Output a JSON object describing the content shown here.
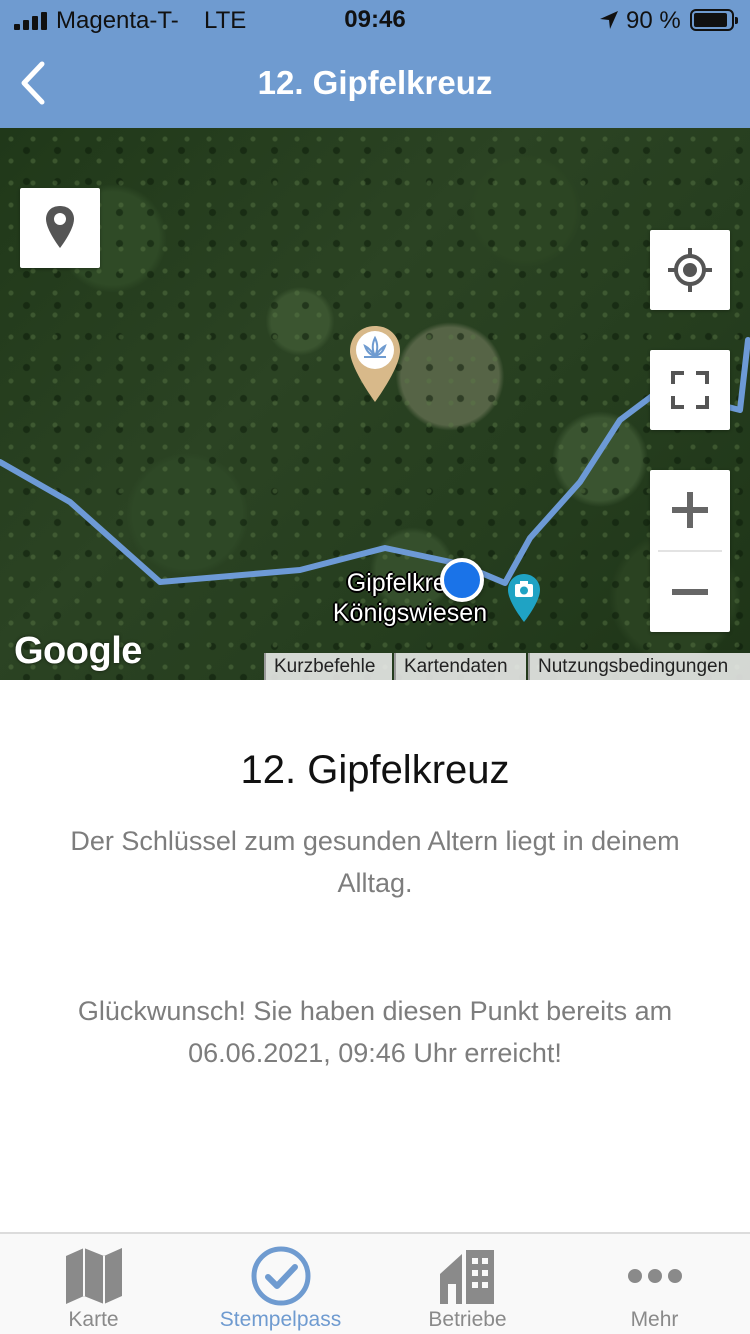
{
  "status_bar": {
    "carrier": "Magenta-T-",
    "network": "LTE",
    "time": "09:46",
    "battery_percent": "90 %"
  },
  "header": {
    "title": "12. Gipfelkreuz",
    "back_icon": "chevron-left-icon",
    "background_color": "#6f9bd0"
  },
  "map": {
    "place_label_line1": "Gipfelkreuz",
    "place_label_line2": "Königswiesen",
    "google_logo": "Google",
    "attribution": [
      "Kurzbefehle",
      "Kartendaten",
      "Nutzungsbedingungen"
    ],
    "controls": {
      "pin": "map-pin-icon",
      "locate": "crosshair-icon",
      "fullscreen": "fullscreen-icon",
      "zoom_in": "plus-icon",
      "zoom_out": "minus-icon"
    },
    "route_color": "#6d9ad6",
    "user_location_color": "#1a73e8"
  },
  "content": {
    "title": "12. Gipfelkreuz",
    "description": "Der Schlüssel zum gesunden Altern liegt in deinem Alltag.",
    "status": "Glückwunsch! Sie haben diesen Punkt bereits am 06.06.2021, 09:46 Uhr erreicht!"
  },
  "tabbar": {
    "active_color": "#6f9bd0",
    "items": [
      {
        "label": "Karte",
        "icon": "map-icon"
      },
      {
        "label": "Stempelpass",
        "icon": "checkmark-circle-icon"
      },
      {
        "label": "Betriebe",
        "icon": "building-icon"
      },
      {
        "label": "Mehr",
        "icon": "more-dots-icon"
      }
    ]
  }
}
